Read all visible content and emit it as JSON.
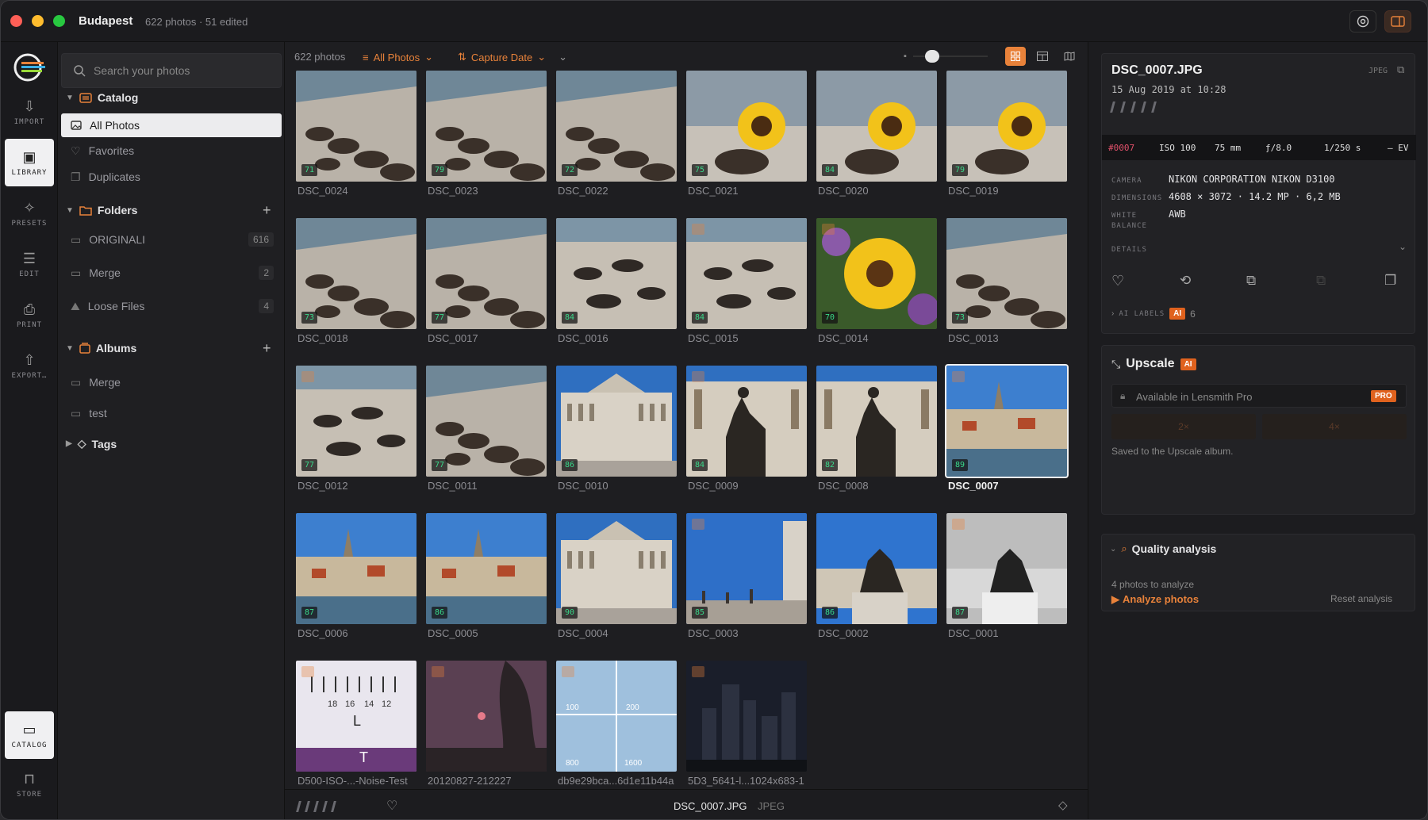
{
  "window": {
    "title": "Budapest",
    "subtitle": "622 photos · 51 edited"
  },
  "rail": [
    {
      "label": "IMPORT",
      "icon": "import-icon"
    },
    {
      "label": "LIBRARY",
      "icon": "library-icon",
      "active": true
    },
    {
      "label": "PRESETS",
      "icon": "presets-icon"
    },
    {
      "label": "EDIT",
      "icon": "edit-icon"
    },
    {
      "label": "PRINT",
      "icon": "print-icon"
    },
    {
      "label": "EXPORT…",
      "icon": "export-icon"
    },
    {
      "label": "CATALOG",
      "icon": "catalog-icon",
      "active": true
    },
    {
      "label": "STORE",
      "icon": "store-icon"
    }
  ],
  "sidebar": {
    "search_placeholder": "Search your photos",
    "catalog": {
      "title": "Catalog",
      "items": [
        "All Photos",
        "Favorites",
        "Duplicates"
      ]
    },
    "folders": {
      "title": "Folders",
      "items": [
        {
          "name": "ORIGINALI",
          "count": "616"
        },
        {
          "name": "Merge",
          "count": "2"
        },
        {
          "name": "Loose Files",
          "count": "4"
        }
      ]
    },
    "albums": {
      "title": "Albums",
      "items": [
        "Merge",
        "test"
      ]
    },
    "tags": {
      "title": "Tags"
    }
  },
  "toolbar": {
    "count": "622 photos",
    "filter": "All Photos",
    "sort": "Capture Date",
    "zoom_level": 0.2
  },
  "photos": [
    {
      "name": "DSC_0024",
      "score": "71",
      "kind": "shoes"
    },
    {
      "name": "DSC_0023",
      "score": "79",
      "kind": "shoes"
    },
    {
      "name": "DSC_0022",
      "score": "72",
      "kind": "shoes"
    },
    {
      "name": "DSC_0021",
      "score": "75",
      "kind": "sunflower"
    },
    {
      "name": "DSC_0020",
      "score": "84",
      "kind": "sunflower"
    },
    {
      "name": "DSC_0019",
      "score": "79",
      "kind": "sunflower"
    },
    {
      "name": "DSC_0018",
      "score": "73",
      "kind": "shoes"
    },
    {
      "name": "DSC_0017",
      "score": "77",
      "kind": "shoes"
    },
    {
      "name": "DSC_0016",
      "score": "84",
      "kind": "stone"
    },
    {
      "name": "DSC_0015",
      "score": "84",
      "kind": "stone",
      "tagged": true
    },
    {
      "name": "DSC_0014",
      "score": "70",
      "kind": "flower",
      "tagged": true
    },
    {
      "name": "DSC_0013",
      "score": "73",
      "kind": "shoes"
    },
    {
      "name": "DSC_0012",
      "score": "77",
      "kind": "stone",
      "tagged": true
    },
    {
      "name": "DSC_0011",
      "score": "77",
      "kind": "shoes"
    },
    {
      "name": "DSC_0010",
      "score": "86",
      "kind": "parliament"
    },
    {
      "name": "DSC_0009",
      "score": "84",
      "kind": "statue",
      "tagged": true
    },
    {
      "name": "DSC_0008",
      "score": "82",
      "kind": "statue"
    },
    {
      "name": "DSC_0007",
      "score": "89",
      "kind": "castle",
      "tagged": true,
      "selected": true
    },
    {
      "name": "DSC_0006",
      "score": "87",
      "kind": "castle"
    },
    {
      "name": "DSC_0005",
      "score": "86",
      "kind": "castle"
    },
    {
      "name": "DSC_0004",
      "score": "90",
      "kind": "parliament"
    },
    {
      "name": "DSC_0003",
      "score": "85",
      "kind": "square",
      "tagged": true
    },
    {
      "name": "DSC_0002",
      "score": "86",
      "kind": "statue2"
    },
    {
      "name": "DSC_0001",
      "score": "87",
      "kind": "statue2bw",
      "tagged": true
    },
    {
      "name": "D500-ISO-...-Noise-Test",
      "score": "",
      "kind": "ruler",
      "tagged": true
    },
    {
      "name": "20120827-212227",
      "score": "",
      "kind": "dusk",
      "tagged": true
    },
    {
      "name": "db9e29bca...6d1e11b44a",
      "score": "",
      "kind": "gridblue",
      "tagged": true
    },
    {
      "name": "5D3_5641-l...1024x683-1",
      "score": "",
      "kind": "night",
      "tagged": true
    }
  ],
  "gridlabels": {
    "a": "18",
    "b": "16",
    "c": "14",
    "d": "12",
    "e": "L",
    "f": "T",
    "g": "100",
    "h": "200",
    "i": "800",
    "j": "1600"
  },
  "statusbar": {
    "file": "DSC_0007.JPG",
    "ext": "JPEG"
  },
  "info": {
    "filename": "DSC_0007.JPG",
    "format": "JPEG",
    "date": "15 Aug 2019 at 10:28",
    "exif": {
      "frame": "#0007",
      "iso": "ISO 100",
      "focal": "75 mm",
      "aperture": "ƒ/8.0",
      "shutter": "1/250 s",
      "ev": "– EV"
    },
    "camera_label": "CAMERA",
    "camera": "NIKON CORPORATION NIKON D3100",
    "dimensions_label": "DIMENSIONS",
    "dimensions": "4608 × 3072 · 14.2 MP · 6,2 MB",
    "wb_label_1": "WHITE",
    "wb_label_2": "BALANCE",
    "wb": "AWB",
    "details": "DETAILS",
    "ai_labels": "AI LABELS",
    "ai_badge": "AI",
    "ai_count": "6"
  },
  "upscale": {
    "title": "Upscale",
    "badge": "AI",
    "availability": "Available in Lensmith Pro",
    "pro": "PRO",
    "opt1": "2×",
    "opt2": "4×",
    "saved": "Saved to the Upscale album."
  },
  "quality": {
    "title": "Quality analysis",
    "count": "4 photos to analyze",
    "analyze": "Analyze photos",
    "reset": "Reset analysis"
  },
  "colors": {
    "accent": "#e8823a",
    "score": "#39d98a"
  }
}
